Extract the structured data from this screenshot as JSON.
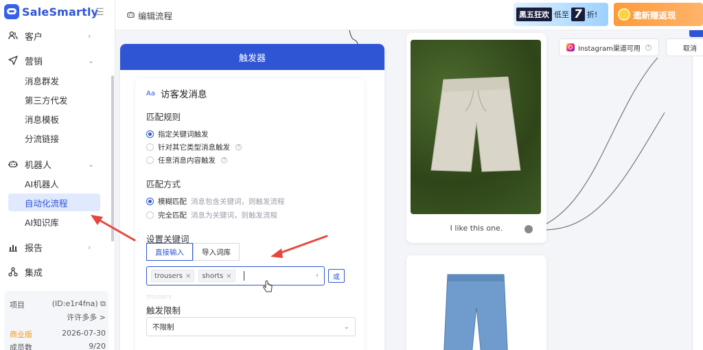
{
  "brand": {
    "name": "SaleSmartly"
  },
  "sidebar": {
    "groups": [
      {
        "label": "客户",
        "icon": "customers-icon"
      },
      {
        "label": "营销",
        "icon": "send-icon"
      },
      {
        "label": "机器人",
        "icon": "robot-icon"
      },
      {
        "label": "报告",
        "icon": "chart-icon"
      },
      {
        "label": "集成",
        "icon": "integration-icon"
      }
    ],
    "marketing_items": [
      "消息群发",
      "第三方代发",
      "消息模板",
      "分流链接"
    ],
    "robot_items": [
      "AI机器人",
      "自动化流程",
      "AI知识库"
    ],
    "active_item": "自动化流程"
  },
  "project": {
    "label": "项目",
    "id": "(ID:e1r4fna)",
    "owner": "许许多多 >",
    "edition": "商业版",
    "expiry": "2026-07-30",
    "members_label": "成员数",
    "members_value": "9/20"
  },
  "topbar": {
    "title": "编辑流程",
    "promo1": {
      "badge": "黑五狂欢",
      "text": "低至",
      "number": "7",
      "suffix": "折!"
    },
    "promo2": {
      "text": "邀新赚返现"
    }
  },
  "trigger": {
    "header": "触发器",
    "card_icon": "Aa",
    "card_title": "访客发消息",
    "match_rule_label": "匹配规则",
    "match_rules": [
      "指定关键词触发",
      "针对其它类型消息触发",
      "任意消息内容触发"
    ],
    "match_mode_label": "匹配方式",
    "match_modes": [
      {
        "label": "模糊匹配",
        "desc": "消息包含关键词，则触发流程"
      },
      {
        "label": "完全匹配",
        "desc": "消息为关键词，则触发流程"
      }
    ],
    "keyword_label": "设置关键词",
    "keyword_tabs": [
      "直接输入",
      "导入词库"
    ],
    "keywords": [
      "trousers",
      "shorts"
    ],
    "or_button": "或",
    "ghost_option": "trousers",
    "limit_label": "触发限制",
    "limit_value": "不限制"
  },
  "canvas": {
    "product1_caption": "I like this one.",
    "instagram_chip": "Instagram渠道可用",
    "cancel_label": "取消"
  },
  "colors": {
    "brand": "#2f55d4",
    "active_bg": "#e1e9fe",
    "edition": "#f39b1e",
    "annotation": "#e8453c"
  }
}
